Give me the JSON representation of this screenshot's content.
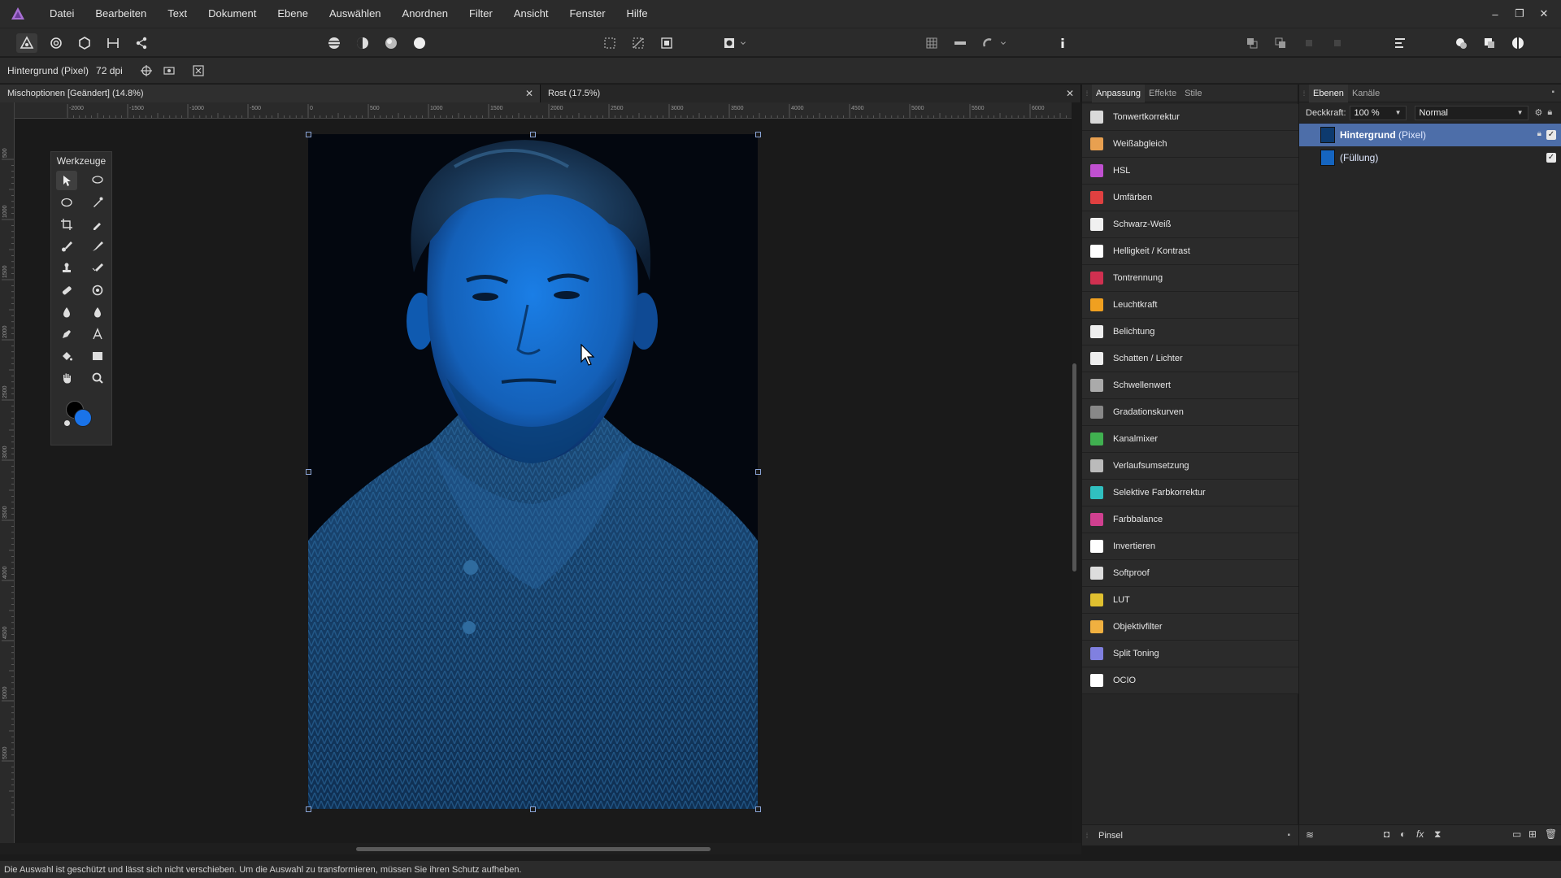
{
  "app": {
    "logo_icon": "affinity-photo-logo-icon",
    "accent": "#4d6ea9"
  },
  "menu": [
    "Datei",
    "Bearbeiten",
    "Text",
    "Dokument",
    "Ebene",
    "Auswählen",
    "Anordnen",
    "Filter",
    "Ansicht",
    "Fenster",
    "Hilfe"
  ],
  "window_controls": {
    "minimize": "–",
    "restore": "❐",
    "close": "✕"
  },
  "context": {
    "layer_info": "Hintergrund (Pixel)",
    "dpi": "72 dpi"
  },
  "tabs": [
    {
      "label": "Mischoptionen [Geändert] (14.8%)",
      "close": "✕"
    },
    {
      "label": "Rost (17.5%)",
      "close": "✕"
    }
  ],
  "ruler_top_labels": [
    "-2000",
    "-1500",
    "-1000",
    "-500",
    "0",
    "500",
    "1000",
    "1500",
    "2000",
    "2500",
    "3000",
    "3500",
    "4000",
    "4500",
    "5000",
    "5500",
    "6000"
  ],
  "ruler_left_labels": [
    "500",
    "1000",
    "1500",
    "2000",
    "2500",
    "3000",
    "3500",
    "4000",
    "4500",
    "5000",
    "5500"
  ],
  "tools": {
    "title": "Werkzeuge",
    "items": [
      "move-tool-icon",
      "selection-brush-icon",
      "freehand-selection-icon",
      "color-picker-icon",
      "crop-icon",
      "eyedropper-icon",
      "paint-brush-icon",
      "pixel-brush-icon",
      "clone-stamp-icon",
      "retouch-brush-icon",
      "healing-brush-icon",
      "red-eye-icon",
      "dodge-icon",
      "burn-icon",
      "pen-icon",
      "text-icon",
      "fill-icon",
      "rectangle-icon",
      "hand-icon",
      "zoom-icon"
    ],
    "primary_color": "#000000",
    "secondary_color": "#1a73e8"
  },
  "adjust_panel": {
    "tabs": [
      "Anpassung",
      "Effekte",
      "Stile"
    ],
    "items": [
      {
        "label": "Tonwertkorrektur",
        "color": "#d9d9d9"
      },
      {
        "label": "Weißabgleich",
        "color": "#e8a050"
      },
      {
        "label": "HSL",
        "color": "#c050d0"
      },
      {
        "label": "Umfärben",
        "color": "#e04040"
      },
      {
        "label": "Schwarz-Weiß",
        "color": "#f0f0f0"
      },
      {
        "label": "Helligkeit / Kontrast",
        "color": "#ffffff"
      },
      {
        "label": "Tontrennung",
        "color": "#d03050"
      },
      {
        "label": "Leuchtkraft",
        "color": "#f0a020"
      },
      {
        "label": "Belichtung",
        "color": "#eeeeee"
      },
      {
        "label": "Schatten / Lichter",
        "color": "#eeeeee"
      },
      {
        "label": "Schwellenwert",
        "color": "#aaaaaa"
      },
      {
        "label": "Gradationskurven",
        "color": "#888888"
      },
      {
        "label": "Kanalmixer",
        "color": "#40b050"
      },
      {
        "label": "Verlaufsumsetzung",
        "color": "#bbbbbb"
      },
      {
        "label": "Selektive Farbkorrektur",
        "color": "#30c0c0"
      },
      {
        "label": "Farbbalance",
        "color": "#d04090"
      },
      {
        "label": "Invertieren",
        "color": "#ffffff"
      },
      {
        "label": "Softproof",
        "color": "#dddddd"
      },
      {
        "label": "LUT",
        "color": "#e0c030"
      },
      {
        "label": "Objektivfilter",
        "color": "#f0b040"
      },
      {
        "label": "Split Toning",
        "color": "#8080e0"
      },
      {
        "label": "OCIO",
        "color": "#ffffff"
      }
    ],
    "footer_label": "Pinsel"
  },
  "layers_panel": {
    "tabs": [
      "Ebenen",
      "Kanäle"
    ],
    "opacity_label": "Deckkraft:",
    "opacity_value": "100 %",
    "blend_mode": "Normal",
    "layers": [
      {
        "name": "Hintergrund",
        "type": "(Pixel)",
        "selected": true,
        "visible": true
      },
      {
        "name": "",
        "type": "(Füllung)",
        "selected": false,
        "visible": true
      }
    ]
  },
  "status": "Die Auswahl ist geschützt und lässt sich nicht verschieben. Um die Auswahl zu transformieren, müssen Sie ihren Schutz aufheben."
}
